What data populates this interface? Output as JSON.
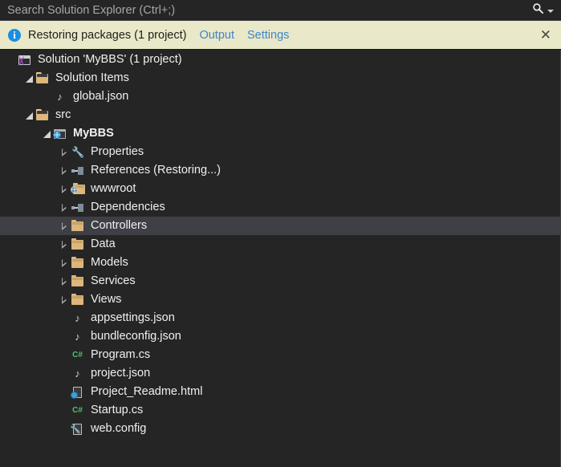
{
  "search": {
    "placeholder": "Search Solution Explorer (Ctrl+;)",
    "value": "",
    "icon": "search-icon",
    "dropdown_icon": "chevron-down-icon"
  },
  "infobar": {
    "icon": "info-circle-icon",
    "message": "Restoring packages (1 project)",
    "links": [
      {
        "label": "Output"
      },
      {
        "label": "Settings"
      }
    ],
    "close_label": "✕",
    "background": "#e9e8c8",
    "link_color": "#3e86c8",
    "text_color": "#1e1e1e"
  },
  "colors": {
    "pane_background": "#252526",
    "selection": "#3f3f46",
    "folder": "#dcb67a",
    "csharp_green": "#4ec26a",
    "globe_blue": "#3f9fdc",
    "vs_purple": "#b44ae0",
    "text": "#f0f0f0"
  },
  "tree": {
    "nodes": [
      {
        "label": "Solution 'MyBBS' (1 project)",
        "indent": 0,
        "twisty": "none",
        "icon": "vs-solution-icon",
        "bold": false,
        "selected": false
      },
      {
        "label": "Solution Items",
        "indent": 1,
        "twisty": "expanded",
        "icon": "folder-open-icon",
        "bold": false,
        "selected": false
      },
      {
        "label": "global.json",
        "indent": 2,
        "twisty": "none",
        "icon": "json-file-icon",
        "bold": false,
        "selected": false
      },
      {
        "label": "src",
        "indent": 1,
        "twisty": "expanded",
        "icon": "folder-open-icon",
        "bold": false,
        "selected": false
      },
      {
        "label": "MyBBS",
        "indent": 2,
        "twisty": "expanded",
        "icon": "web-project-icon",
        "bold": true,
        "selected": false
      },
      {
        "label": "Properties",
        "indent": 3,
        "twisty": "collapsed",
        "icon": "wrench-icon",
        "bold": false,
        "selected": false
      },
      {
        "label": "References (Restoring...)",
        "indent": 3,
        "twisty": "collapsed",
        "icon": "references-icon",
        "bold": false,
        "selected": false
      },
      {
        "label": "wwwroot",
        "indent": 3,
        "twisty": "collapsed",
        "icon": "wwwroot-icon",
        "bold": false,
        "selected": false
      },
      {
        "label": "Dependencies",
        "indent": 3,
        "twisty": "collapsed",
        "icon": "references-icon",
        "bold": false,
        "selected": false
      },
      {
        "label": "Controllers",
        "indent": 3,
        "twisty": "collapsed",
        "icon": "folder-icon",
        "bold": false,
        "selected": true
      },
      {
        "label": "Data",
        "indent": 3,
        "twisty": "collapsed",
        "icon": "folder-icon",
        "bold": false,
        "selected": false
      },
      {
        "label": "Models",
        "indent": 3,
        "twisty": "collapsed",
        "icon": "folder-icon",
        "bold": false,
        "selected": false
      },
      {
        "label": "Services",
        "indent": 3,
        "twisty": "collapsed",
        "icon": "folder-icon",
        "bold": false,
        "selected": false
      },
      {
        "label": "Views",
        "indent": 3,
        "twisty": "collapsed",
        "icon": "folder-icon",
        "bold": false,
        "selected": false
      },
      {
        "label": "appsettings.json",
        "indent": 3,
        "twisty": "none",
        "icon": "json-file-icon",
        "bold": false,
        "selected": false
      },
      {
        "label": "bundleconfig.json",
        "indent": 3,
        "twisty": "none",
        "icon": "json-file-icon",
        "bold": false,
        "selected": false
      },
      {
        "label": "Program.cs",
        "indent": 3,
        "twisty": "none",
        "icon": "csharp-file-icon",
        "bold": false,
        "selected": false
      },
      {
        "label": "project.json",
        "indent": 3,
        "twisty": "none",
        "icon": "json-file-icon",
        "bold": false,
        "selected": false
      },
      {
        "label": "Project_Readme.html",
        "indent": 3,
        "twisty": "none",
        "icon": "html-file-icon",
        "bold": false,
        "selected": false
      },
      {
        "label": "Startup.cs",
        "indent": 3,
        "twisty": "none",
        "icon": "csharp-file-icon",
        "bold": false,
        "selected": false
      },
      {
        "label": "web.config",
        "indent": 3,
        "twisty": "none",
        "icon": "config-file-icon",
        "bold": false,
        "selected": false
      }
    ]
  }
}
